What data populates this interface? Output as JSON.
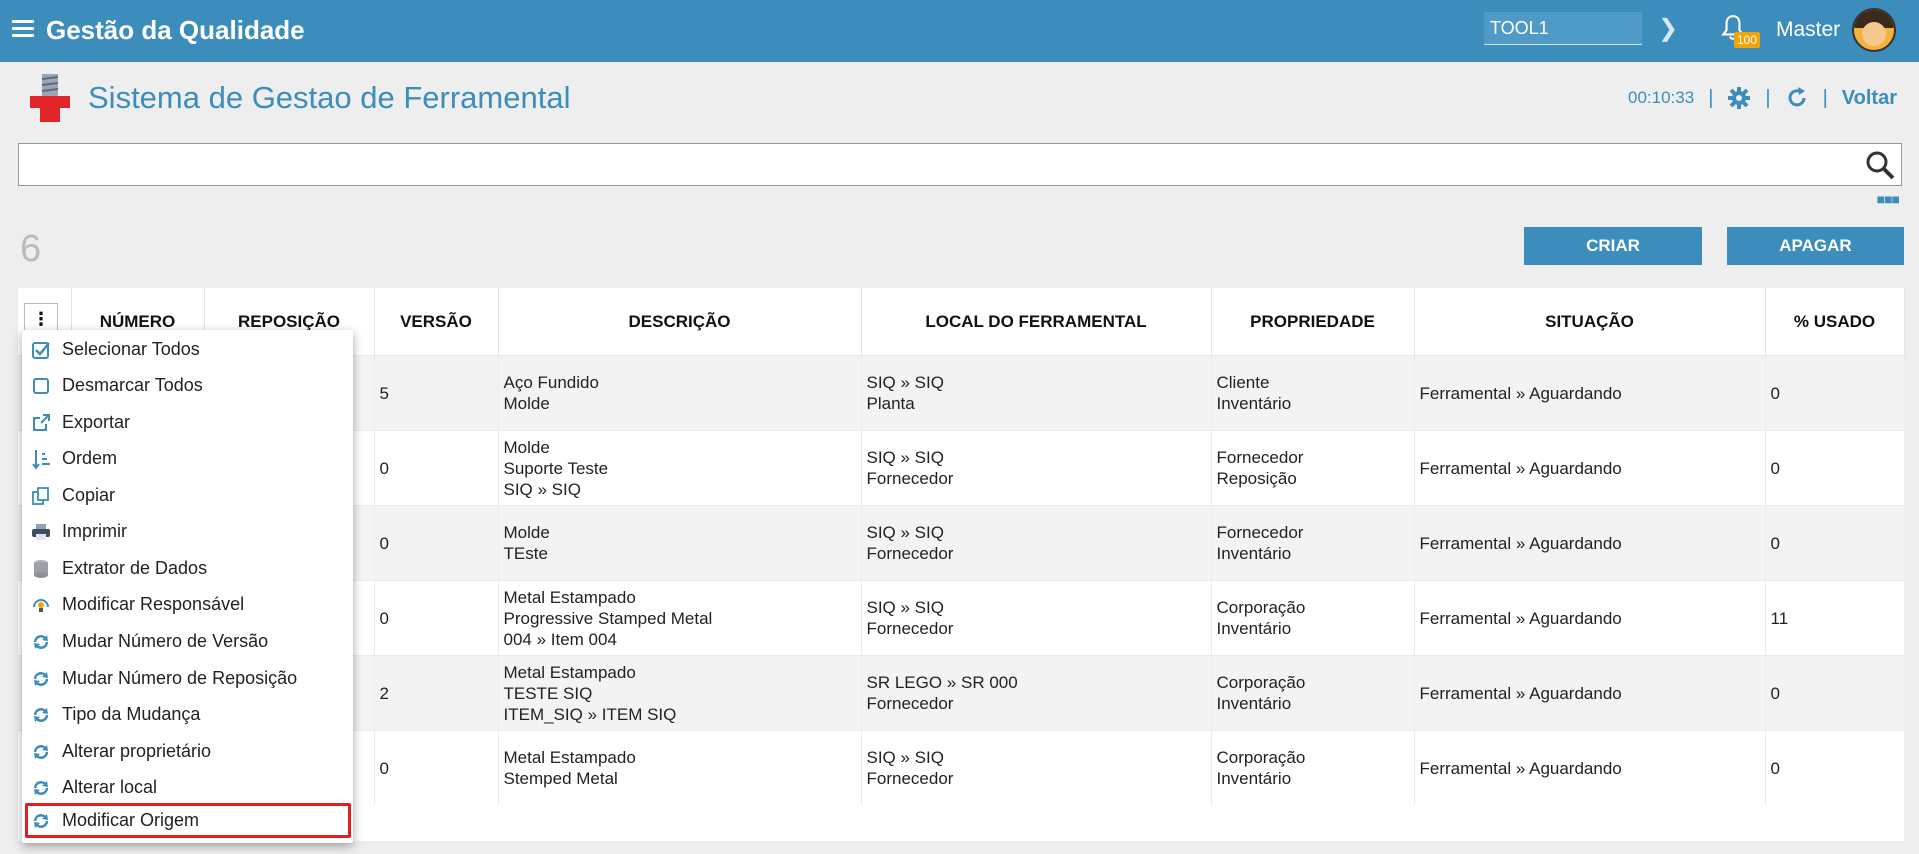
{
  "topbar": {
    "app_title": "Gestão da Qualidade",
    "tool_value": "TOOL1",
    "notification_count": "100",
    "user_name": "Master"
  },
  "header": {
    "page_title": "Sistema de Gestao de Ferramental",
    "timer": "00:10:33",
    "voltar_label": "Voltar"
  },
  "search": {
    "value": ""
  },
  "toolbar": {
    "record_count": "6",
    "criar_label": "CRIAR",
    "apagar_label": "APAGAR"
  },
  "table": {
    "columns": [
      "NÚMERO",
      "REPOSIÇÃO",
      "VERSÃO",
      "DESCRIÇÃO",
      "LOCAL DO FERRAMENTAL",
      "PROPRIEDADE",
      "SITUAÇÃO",
      "% USADO"
    ],
    "rows": [
      {
        "versao": "5",
        "descricao": [
          "Aço Fundido",
          "Molde",
          ""
        ],
        "local": [
          "SIQ » SIQ",
          "Planta"
        ],
        "propriedade": [
          "Cliente",
          "Inventário"
        ],
        "situacao": "Ferramental » Aguardando",
        "usado": "0"
      },
      {
        "versao": "0",
        "descricao": [
          "Molde",
          "Suporte Teste",
          "SIQ » SIQ"
        ],
        "local": [
          "SIQ » SIQ",
          "Fornecedor"
        ],
        "propriedade": [
          "Fornecedor",
          "Reposição"
        ],
        "situacao": "Ferramental » Aguardando",
        "usado": "0"
      },
      {
        "versao": "0",
        "descricao": [
          "Molde",
          "TEste",
          ""
        ],
        "local": [
          "SIQ » SIQ",
          "Fornecedor"
        ],
        "propriedade": [
          "Fornecedor",
          "Inventário"
        ],
        "situacao": "Ferramental » Aguardando",
        "usado": "0"
      },
      {
        "versao": "0",
        "descricao": [
          "Metal Estampado",
          "Progressive Stamped Metal",
          "004 » Item 004"
        ],
        "local": [
          "SIQ » SIQ",
          "Fornecedor"
        ],
        "propriedade": [
          "Corporação",
          "Inventário"
        ],
        "situacao": "Ferramental » Aguardando",
        "usado": "11"
      },
      {
        "versao": "2",
        "descricao": [
          "Metal Estampado",
          "TESTE SIQ",
          "ITEM_SIQ » ITEM SIQ"
        ],
        "local": [
          "SR LEGO » SR 000",
          "Fornecedor"
        ],
        "propriedade": [
          "Corporação",
          "Inventário"
        ],
        "situacao": "Ferramental » Aguardando",
        "usado": "0"
      },
      {
        "versao": "0",
        "descricao": [
          "Metal Estampado",
          "Stemped Metal",
          ""
        ],
        "local": [
          "SIQ » SIQ",
          "Fornecedor"
        ],
        "propriedade": [
          "Corporação",
          "Inventário"
        ],
        "situacao": "Ferramental » Aguardando",
        "usado": "0"
      }
    ]
  },
  "menu": {
    "items": [
      {
        "label": "Selecionar Todos",
        "icon": "checkbox-checked-icon"
      },
      {
        "label": "Desmarcar Todos",
        "icon": "checkbox-empty-icon"
      },
      {
        "label": "Exportar",
        "icon": "export-icon"
      },
      {
        "label": "Ordem",
        "icon": "sort-icon"
      },
      {
        "label": "Copiar",
        "icon": "copy-icon"
      },
      {
        "label": "Imprimir",
        "icon": "printer-icon"
      },
      {
        "label": "Extrator de Dados",
        "icon": "database-icon"
      },
      {
        "label": "Modificar Responsável",
        "icon": "user-change-icon"
      },
      {
        "label": "Mudar Número de Versão",
        "icon": "refresh-icon"
      },
      {
        "label": "Mudar Número de Reposição",
        "icon": "refresh-icon"
      },
      {
        "label": "Tipo da Mudança",
        "icon": "refresh-icon"
      },
      {
        "label": "Alterar proprietário",
        "icon": "refresh-icon"
      },
      {
        "label": "Alterar local",
        "icon": "refresh-icon"
      },
      {
        "label": "Modificar Origem",
        "icon": "refresh-icon",
        "highlighted": true
      }
    ]
  },
  "colors": {
    "primary": "#3c8dbc",
    "highlight_border": "#e02020",
    "badge": "#f0a30a"
  }
}
